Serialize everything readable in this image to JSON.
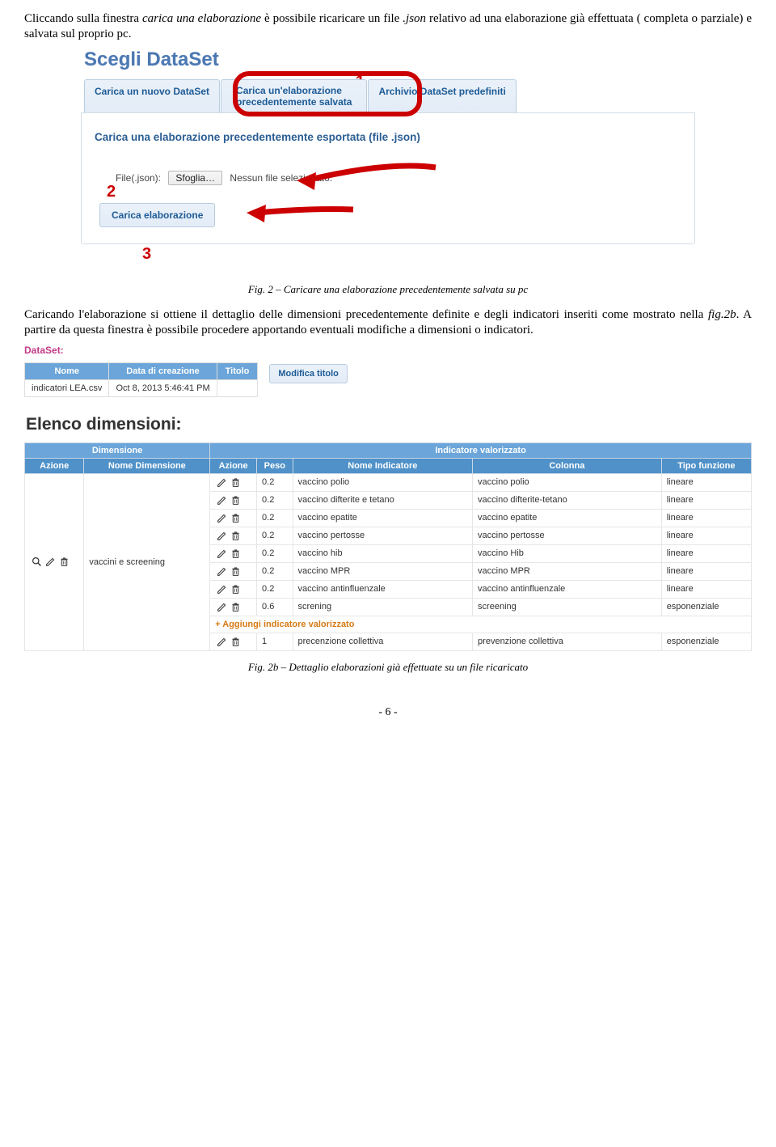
{
  "intro": {
    "text_before_italic": "Cliccando sulla finestra ",
    "italic1": "carica una elaborazione",
    "text_mid": " è possibile ricaricare un file ",
    "italic2": ".json",
    "text_after": " relativo ad una elaborazione già effettuata ( completa o parziale) e salvata sul proprio pc."
  },
  "annot": {
    "a1": "1",
    "a2": "2",
    "a3": "3"
  },
  "shot1": {
    "heading": "Scegli DataSet",
    "tabs": {
      "t1": "Carica un nuovo DataSet",
      "t2a": "Carica un'elaborazione",
      "t2b": "precedentemente salvata",
      "t3": "Archivio DataSet predefiniti"
    },
    "panel_title": "Carica una elaborazione precedentemente esportata (file .json)",
    "file_label": "File(.json):",
    "sfoglia": "Sfoglia…",
    "no_file": "Nessun file selezionato.",
    "carica_btn": "Carica elaborazione"
  },
  "fig2": "Fig. 2 – Caricare una elaborazione precedentemente salvata su pc",
  "mid": {
    "t1": "Caricando l'elaborazione si ottiene il dettaglio delle dimensioni precedentemente definite e degli indicatori inseriti come mostrato nella ",
    "i1": "fig.2b",
    "t2": ". A partire da questa finestra è possibile procedere apportando eventuali modifiche a dimensioni o indicatori."
  },
  "shot2": {
    "ds_label": "DataSet:",
    "mini_headers": {
      "c1": "Nome",
      "c2": "Data di creazione",
      "c3": "Titolo"
    },
    "mini_row": {
      "nome": "indicatori LEA.csv",
      "data": "Oct 8, 2013 5:46:41 PM",
      "titolo": ""
    },
    "modifica": "Modifica titolo",
    "elenco": "Elenco dimensioni:",
    "top_headers": {
      "dim": "Dimensione",
      "ind": "Indicatore valorizzato"
    },
    "sub_headers": {
      "az1": "Azione",
      "nd": "Nome Dimensione",
      "az2": "Azione",
      "peso": "Peso",
      "ni": "Nome Indicatore",
      "col": "Colonna",
      "tf": "Tipo funzione"
    },
    "dim_name": "vaccini e screening",
    "rows": [
      {
        "peso": "0.2",
        "nome": "vaccino polio",
        "col": "vaccino polio",
        "tf": "lineare"
      },
      {
        "peso": "0.2",
        "nome": "vaccino difterite e tetano",
        "col": "vaccino difterite-tetano",
        "tf": "lineare"
      },
      {
        "peso": "0.2",
        "nome": "vaccino epatite",
        "col": "vaccino epatite",
        "tf": "lineare"
      },
      {
        "peso": "0.2",
        "nome": "vaccino pertosse",
        "col": "vaccino pertosse",
        "tf": "lineare"
      },
      {
        "peso": "0.2",
        "nome": "vaccino hib",
        "col": "vaccino Hib",
        "tf": "lineare"
      },
      {
        "peso": "0.2",
        "nome": "vaccino MPR",
        "col": "vaccino MPR",
        "tf": "lineare"
      },
      {
        "peso": "0.2",
        "nome": "vaccino antinfluenzale",
        "col": "vaccino antinfluenzale",
        "tf": "lineare"
      },
      {
        "peso": "0.6",
        "nome": "screning",
        "col": "screening",
        "tf": "esponenziale"
      }
    ],
    "add_text": "+ Aggiungi indicatore valorizzato",
    "last_row": {
      "peso": "1",
      "nome": "precenzione collettiva",
      "col": "prevenzione collettiva",
      "tf": "esponenziale"
    }
  },
  "fig2b": "Fig. 2b – Dettaglio elaborazioni già effettuate su un file ricaricato",
  "page_no": "- 6 -"
}
